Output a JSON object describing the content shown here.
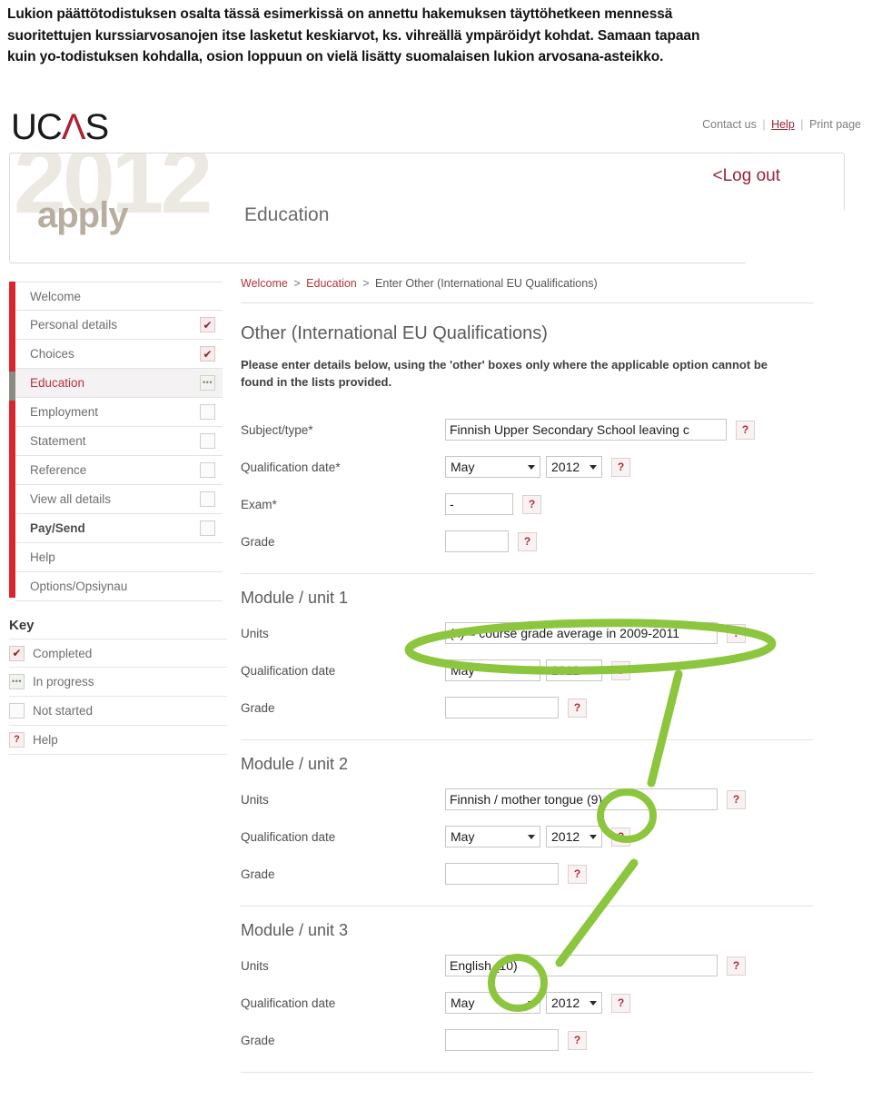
{
  "caption": {
    "lines": [
      "Lukion päättötodistuksen osalta tässä esimerkissä on annettu hakemuksen täyttöhetkeen mennessä",
      "suoritettujen kurssiarvosanojen itse lasketut keskiarvot, ks. vihreällä ympäröidyt kohdat. Samaan tapaan",
      "kuin yo-todistuksen kohdalla, osion loppuun on vielä lisätty suomalaisen lukion arvosana-asteikko."
    ]
  },
  "brand": {
    "logo_part1": "UC",
    "logo_accent": "Λ",
    "logo_part3": "S",
    "watermark_year": "2012",
    "watermark_apply": "apply",
    "banner_title": "Education",
    "logout": "<Log out",
    "accent_color": "#b01f35",
    "nav_red": "#d8262c",
    "annotation_green": "#8cc63e"
  },
  "toplinks": {
    "contact": "Contact us",
    "help": "Help",
    "print": "Print page",
    "separator": "|"
  },
  "sidebar": {
    "items": [
      {
        "label": "Welcome",
        "state": "none",
        "active": false,
        "bold": false
      },
      {
        "label": "Personal details",
        "state": "completed",
        "active": false,
        "bold": false
      },
      {
        "label": "Choices",
        "state": "completed",
        "active": false,
        "bold": false
      },
      {
        "label": "Education",
        "state": "progress",
        "active": true,
        "bold": false
      },
      {
        "label": "Employment",
        "state": "notstarted",
        "active": false,
        "bold": false
      },
      {
        "label": "Statement",
        "state": "notstarted",
        "active": false,
        "bold": false
      },
      {
        "label": "Reference",
        "state": "notstarted",
        "active": false,
        "bold": false
      },
      {
        "label": "View all details",
        "state": "notstarted",
        "active": false,
        "bold": false
      },
      {
        "label": "Pay/Send",
        "state": "notstarted",
        "active": false,
        "bold": true
      },
      {
        "label": "Help",
        "state": "none",
        "active": false,
        "bold": false
      },
      {
        "label": "Options/Opsiynau",
        "state": "none",
        "active": false,
        "bold": false
      }
    ]
  },
  "key": {
    "title": "Key",
    "rows": [
      {
        "label": "Completed",
        "state": "completed",
        "glyph": "✔"
      },
      {
        "label": "In progress",
        "state": "progress",
        "glyph": "•••"
      },
      {
        "label": "Not started",
        "state": "notstarted",
        "glyph": ""
      },
      {
        "label": "Help",
        "state": "qmark",
        "glyph": "?"
      }
    ]
  },
  "main": {
    "breadcrumb": [
      "Welcome",
      "Education",
      "Enter Other (International EU Qualifications)"
    ],
    "breadcrumb_separator": ">",
    "section_title": "Other (International EU Qualifications)",
    "section_intro": "Please enter details below, using the 'other' boxes only where the applicable option cannot be found in the lists provided.",
    "qualification": {
      "subject_label": "Subject/type*",
      "subject_value": "Finnish Upper Secondary School leaving c",
      "date_label": "Qualification date*",
      "date_month": "May",
      "date_year": "2012",
      "exam_label": "Exam*",
      "exam_value": "-",
      "grade_label": "Grade",
      "grade_value": ""
    },
    "modules": [
      {
        "title": "Module / unit 1",
        "units_label": "Units",
        "units_value": "(x) = course grade average in 2009-2011",
        "date_label": "Qualification date",
        "date_month": "May",
        "date_year": "2012",
        "grade_label": "Grade",
        "grade_value": ""
      },
      {
        "title": "Module / unit 2",
        "units_label": "Units",
        "units_value": "Finnish / mother tongue (9)",
        "date_label": "Qualification date",
        "date_month": "May",
        "date_year": "2012",
        "grade_label": "Grade",
        "grade_value": ""
      },
      {
        "title": "Module / unit 3",
        "units_label": "Units",
        "units_value": "English (10)",
        "date_label": "Qualification date",
        "date_month": "May",
        "date_year": "2012",
        "grade_label": "Grade",
        "grade_value": ""
      }
    ],
    "help_glyph": "?"
  }
}
